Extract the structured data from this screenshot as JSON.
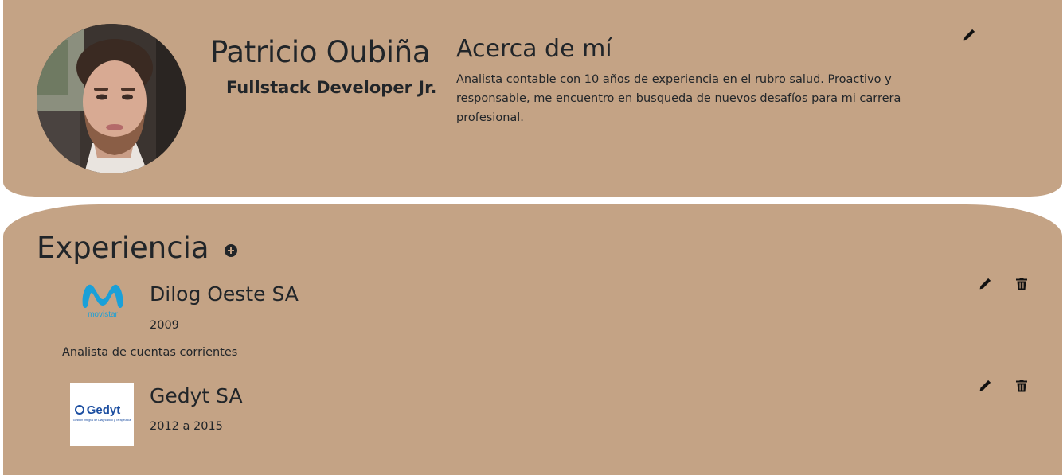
{
  "profile": {
    "name": "Patricio Oubiña",
    "role": "Fullstack Developer Jr.",
    "about_title": "Acerca de mí",
    "about_text": "Analista contable con 10 años de experiencia en el rubro salud. Proactivo y responsable, me encuentro en busqueda de nuevos desafíos para mi carrera profesional.",
    "edit_icon": "pencil-icon"
  },
  "experience": {
    "title": "Experiencia",
    "add_icon": "plus-circle-icon",
    "items": [
      {
        "company": "Dilog Oeste SA",
        "years": "2009",
        "description": "Analista de cuentas corrientes",
        "logo": "movistar",
        "logo_text": "movistar"
      },
      {
        "company": "Gedyt SA",
        "years": "2012 a 2015",
        "description": "",
        "logo": "gedyt",
        "logo_text": "Gedyt",
        "logo_subtext": "Gestion Integral de Diagnostico y Terapeutica"
      }
    ]
  },
  "colors": {
    "card_background": "#c4a385",
    "text": "#212529",
    "movistar_blue": "#1aa0d8",
    "gedyt_blue": "#1d4fa1"
  }
}
